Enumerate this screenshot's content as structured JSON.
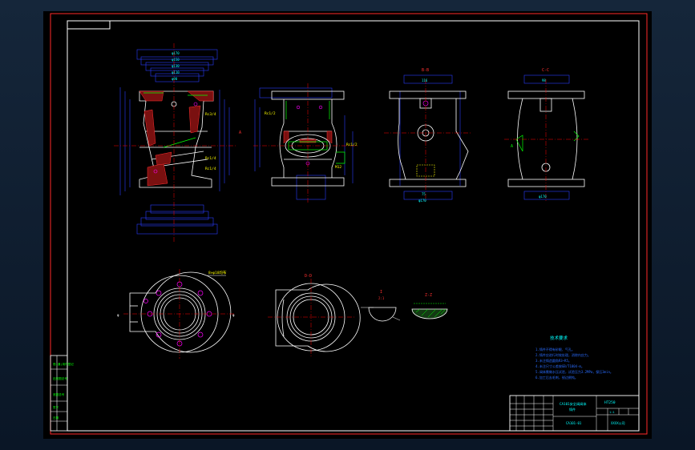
{
  "drawing": {
    "title_block": {
      "part_name": "CA101安全阀阀体",
      "part_sub": "铸件",
      "material": "HT250",
      "scale_code": "1:1",
      "drawing_no": "CA101-01",
      "company": "XXXX公司"
    },
    "left_strip": [
      "借(通)用件登记",
      "旧底图总号",
      "底图总号",
      "签字",
      "日期"
    ],
    "views": {
      "front": {
        "section_label": "A",
        "dims_top": [
          "φ170",
          "φ150",
          "φ130",
          "φ110",
          "φ90"
        ],
        "thread_labels": [
          "Rc3/4",
          "Rc1/4",
          "Rc1/4"
        ]
      },
      "side": {
        "thread_labels": [
          "Rc1/2",
          "Rc1/2",
          "M12"
        ]
      },
      "right1": {
        "section_label": "B-B",
        "dims": [
          "116",
          "75",
          "φ170"
        ]
      },
      "right2": {
        "section_label": "C-C",
        "dims": [
          "98",
          "φ170",
          "A"
        ]
      },
      "bottom_flange": {
        "label": "8×φ18均布",
        "callout": "φ"
      },
      "bottom_section": {
        "label": "D-D"
      },
      "detail1": {
        "label": "I",
        "scale": "2:1"
      },
      "detail2": {
        "label": "Z-Z"
      }
    },
    "notes": {
      "heading": "技术要求",
      "items": [
        "1.铸件不得有砂眼、气孔。",
        "2.铸件应进行时效处理，消除内应力。",
        "3.未注铸造圆角R3~R5。",
        "4.未注尺寸公差按GB/T1804-m。",
        "5.阀体需做水压试验，试验压力3.2MPa，保压3min。",
        "6.加工后去毛刺，锐边倒钝。"
      ]
    },
    "colors": {
      "frame": "#ff2a2a",
      "outline": "#ffffff",
      "dimension": "#2a3cff",
      "text": "#00ffff",
      "hatch": "#ff3030",
      "center": "#ff0000",
      "highlight": "#ff00ff",
      "label": "#ffff00",
      "green": "#00ff00"
    }
  }
}
